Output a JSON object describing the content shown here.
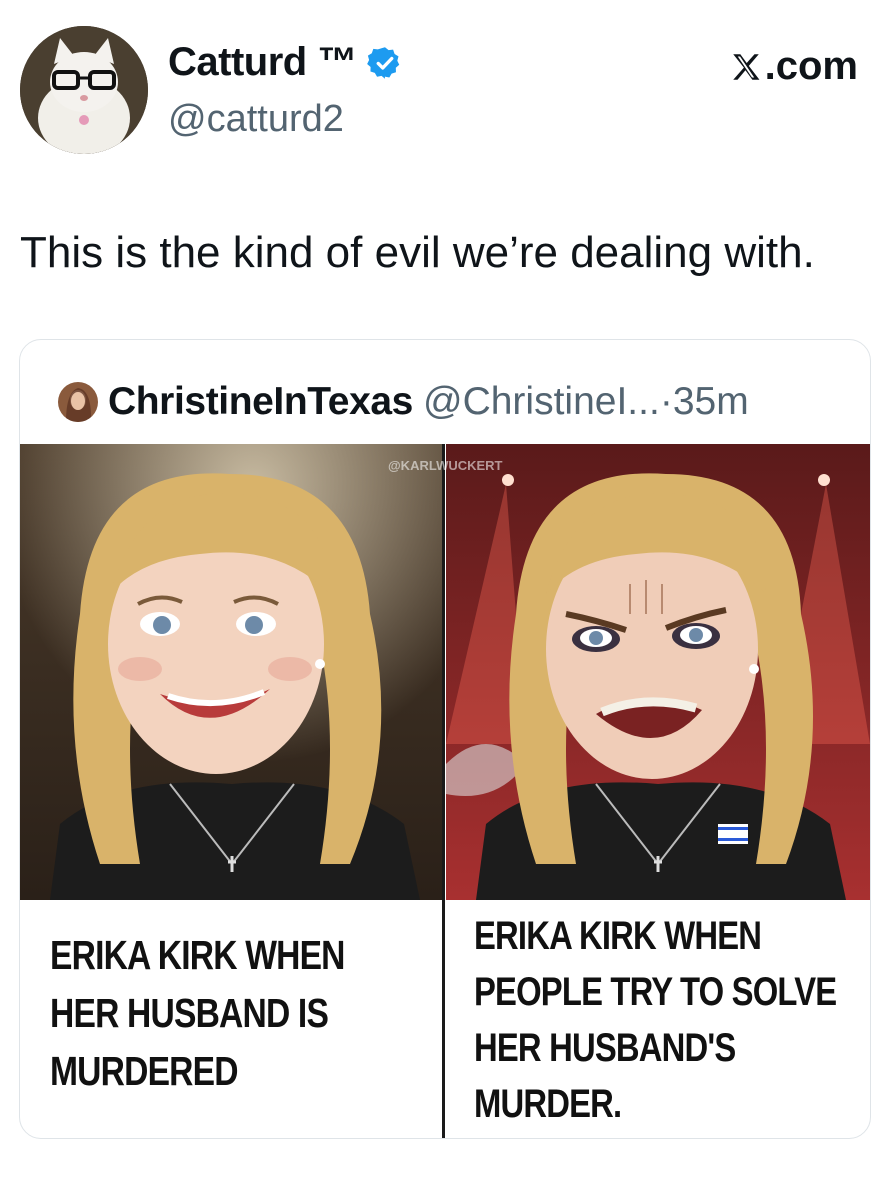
{
  "post": {
    "author_name": "Catturd ™",
    "author_handle": "@catturd2",
    "site_label": ".com",
    "text": "This is the kind of evil we’re dealing with."
  },
  "quoted": {
    "author_name": "ChristineInTexas",
    "author_handle": "@ChristineI...",
    "separator": "·",
    "time": "35m"
  },
  "meme": {
    "watermark": "@KARLWUCKERT",
    "left_caption": [
      "ERIKA KIRK WHEN",
      "HER HUSBAND IS",
      "MURDERED"
    ],
    "right_caption": [
      "ERIKA KIRK WHEN",
      "PEOPLE TRY TO SOLVE",
      "HER HUSBAND'S",
      "MURDER."
    ]
  },
  "icons": {
    "verified": "verified-badge-icon",
    "x_logo": "x-logo-icon"
  },
  "colors": {
    "verified": "#1d9bf0",
    "secondary_text": "#536471",
    "border": "#dfe4e8"
  }
}
